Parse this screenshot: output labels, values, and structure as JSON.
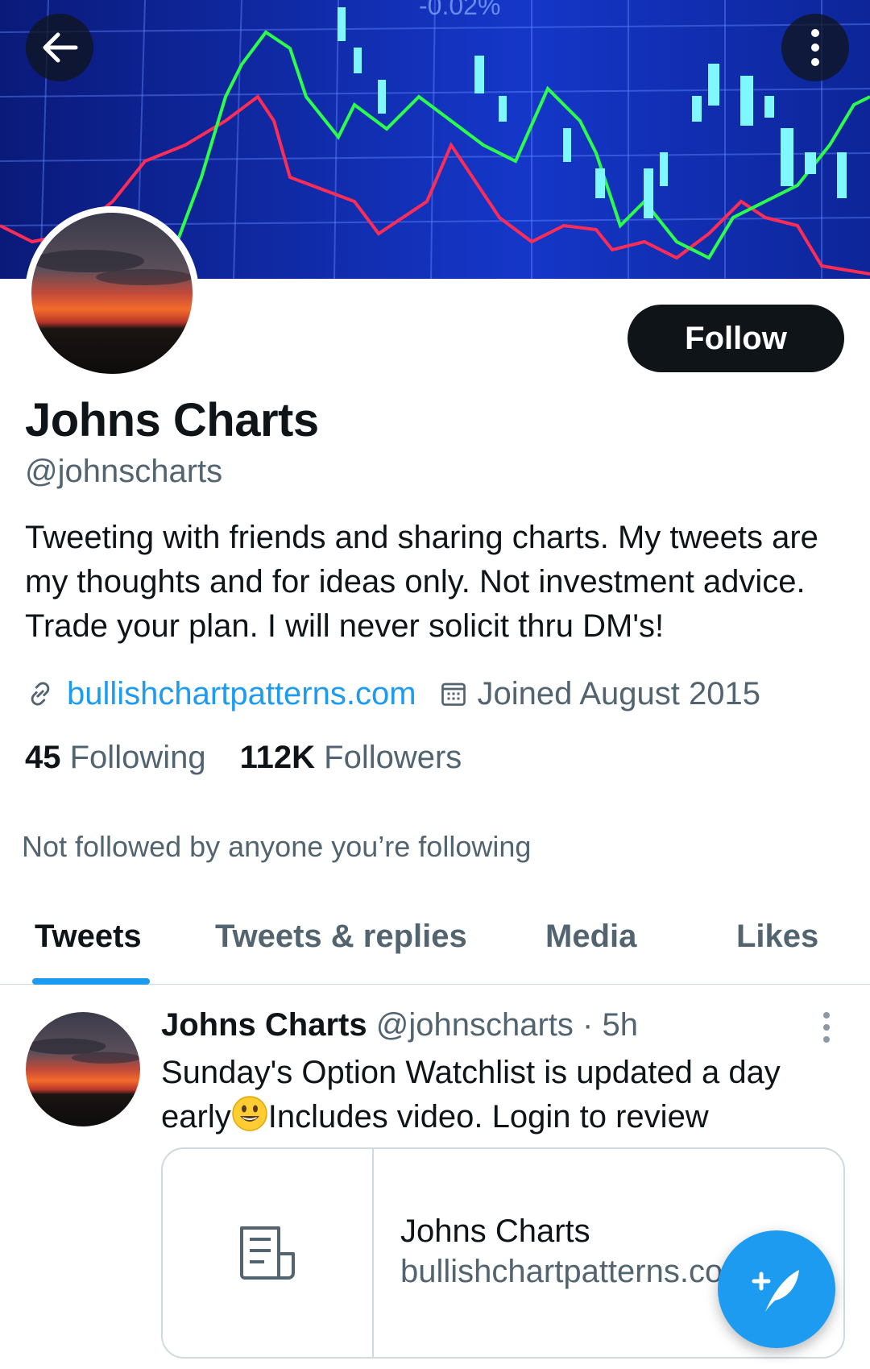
{
  "header": {
    "back_icon": "arrow-left-icon",
    "more_icon": "more-vertical-icon"
  },
  "profile": {
    "name": "Johns Charts",
    "handle": "@johnscharts",
    "bio": "Tweeting with friends and sharing charts. My tweets are my thoughts and for ideas only. Not investment advice. Trade your plan. I will never solicit thru DM's!",
    "website": "bullishchartpatterns.com",
    "joined": "Joined August 2015",
    "following_count": "45",
    "following_label": "Following",
    "followers_count": "112K",
    "followers_label": "Followers",
    "not_followed_text": "Not followed by anyone you’re following",
    "follow_button": "Follow"
  },
  "tabs": [
    {
      "label": "Tweets",
      "active": true
    },
    {
      "label": "Tweets & replies",
      "active": false
    },
    {
      "label": "Media",
      "active": false
    },
    {
      "label": "Likes",
      "active": false
    }
  ],
  "tweet": {
    "author": "Johns Charts",
    "handle": "@johnscharts",
    "time": "· 5h",
    "text_part1": "Sunday's Option Watchlist is updated a day early",
    "text_part2": "Includes video. Login to review",
    "card": {
      "title": "Johns Charts",
      "domain": "bullishchartpatterns.com"
    }
  },
  "colors": {
    "accent": "#1d9bf0",
    "text": "#0f1419",
    "secondary": "#536471",
    "border": "#cfd9de"
  },
  "fab": {
    "icon": "compose-tweet-icon"
  }
}
